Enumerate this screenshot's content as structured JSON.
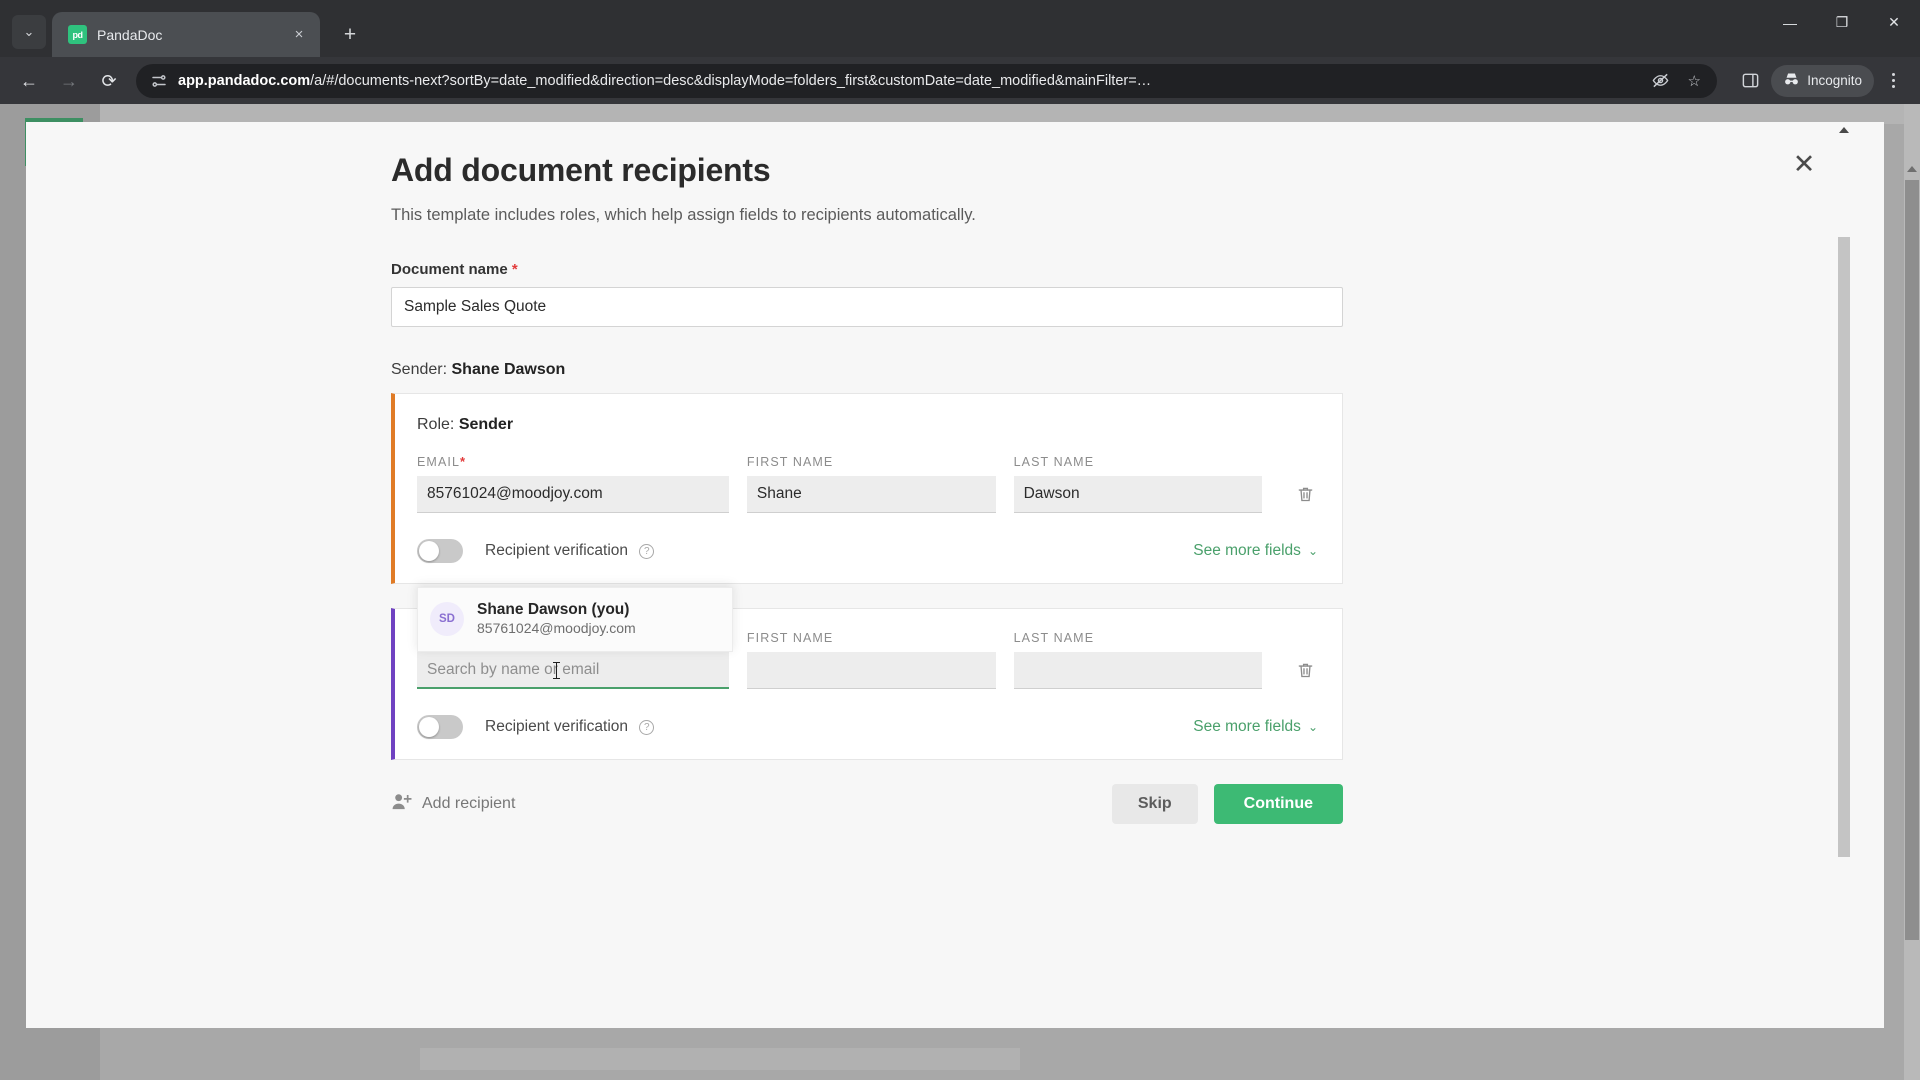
{
  "browser": {
    "tab": {
      "title": "PandaDoc",
      "favicon_label": "pd",
      "close_icon": "×"
    },
    "new_tab_icon": "+",
    "tab_search_icon": "⌄",
    "window_controls": {
      "minimize": "—",
      "maximize": "❐",
      "close": "✕"
    },
    "nav": {
      "back_icon": "←",
      "forward_icon": "→",
      "reload_icon": "⟳"
    },
    "omnibox": {
      "site_settings_icon": "page-info-icon",
      "url_prefix": "app.pandadoc.com",
      "url_rest": "/a/#/documents-next?sortBy=date_modified&direction=desc&displayMode=folders_first&customDate=date_modified&mainFilter=…",
      "tracking_protection_icon": "eye-slash-icon",
      "bookmark_icon": "☆",
      "side_panel_icon": "side-panel-icon"
    },
    "incognito": {
      "label": "Incognito",
      "icon": "incognito-icon"
    },
    "menu_icon": "kebab-menu-icon"
  },
  "modal": {
    "title": "Add document recipients",
    "subtitle": "This template includes roles, which help assign fields to recipients automatically.",
    "close_icon": "✕",
    "document_name": {
      "label": "Document name",
      "required_mark": "*",
      "value": "Sample Sales Quote"
    },
    "sender_line": {
      "prefix": "Sender:",
      "name": "Shane Dawson"
    },
    "recipients": [
      {
        "accent_color": "#e07b26",
        "role_prefix": "Role:",
        "role_name": "Sender",
        "email_label": "EMAIL",
        "email_required": "*",
        "email_value": "85761024@moodjoy.com",
        "first_name_label": "FIRST NAME",
        "first_name_value": "Shane",
        "last_name_label": "LAST NAME",
        "last_name_value": "Dawson",
        "delete_icon": "trash-icon",
        "verification_label": "Recipient verification",
        "verification_info_icon": "?",
        "verification_on": false,
        "see_more_label": "See more fields",
        "see_more_chevron": "⌄"
      },
      {
        "accent_color": "#6f42c1",
        "email_label": "",
        "email_placeholder": "Search by name or email",
        "first_name_label": "FIRST NAME",
        "first_name_value": "",
        "last_name_label": "LAST NAME",
        "last_name_value": "",
        "delete_icon": "trash-icon",
        "verification_label": "Recipient verification",
        "verification_info_icon": "?",
        "verification_on": false,
        "see_more_label": "See more fields",
        "see_more_chevron": "⌄",
        "autocomplete": {
          "avatar_initials": "SD",
          "name": "Shane Dawson (you)",
          "email": "85761024@moodjoy.com"
        }
      }
    ],
    "add_recipient": {
      "label": "Add recipient",
      "icon": "user-plus-icon"
    },
    "skip_label": "Skip",
    "continue_label": "Continue",
    "accent_green": "#3dba74"
  }
}
